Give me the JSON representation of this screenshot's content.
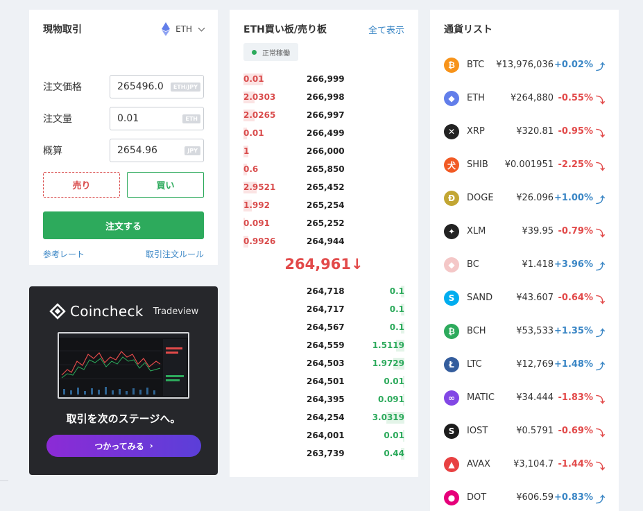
{
  "trade": {
    "title": "現物取引",
    "coin": "ETH",
    "rows": [
      {
        "label": "注文価格",
        "value": "265496.0",
        "unit": "ETH/JPY"
      },
      {
        "label": "注文量",
        "value": "0.01",
        "unit": "ETH"
      },
      {
        "label": "概算",
        "value": "2654.96",
        "unit": "JPY"
      }
    ],
    "sell_label": "売り",
    "buy_label": "買い",
    "order_label": "注文する",
    "ref_rate_link": "参考レート",
    "rules_link": "取引注文ルール"
  },
  "banner": {
    "brand": "Coincheck",
    "sub": "Tradeview",
    "caption": "取引を次のステージへ。",
    "button_label": "つかってみる"
  },
  "book": {
    "title": "ETH買い板/売り板",
    "show_all": "全て表示",
    "status": "正常稼働",
    "last_price": "264,961",
    "last_arrow": "↓",
    "asks": [
      {
        "qty": "0.01",
        "price": "266,999",
        "depth": 0.12
      },
      {
        "qty": "2.0303",
        "price": "266,998",
        "depth": 0.07
      },
      {
        "qty": "2.0265",
        "price": "266,997",
        "depth": 0.07
      },
      {
        "qty": "0.01",
        "price": "266,499",
        "depth": 0.02
      },
      {
        "qty": "1",
        "price": "266,000",
        "depth": 0.03
      },
      {
        "qty": "0.6",
        "price": "265,850",
        "depth": 0.02
      },
      {
        "qty": "2.9521",
        "price": "265,452",
        "depth": 0.08
      },
      {
        "qty": "1.992",
        "price": "265,254",
        "depth": 0.05
      },
      {
        "qty": "0.091",
        "price": "265,252",
        "depth": 0.01
      },
      {
        "qty": "0.9926",
        "price": "264,944",
        "depth": 0.03
      }
    ],
    "bids": [
      {
        "price": "264,718",
        "qty": "0.1",
        "depth": 0.02
      },
      {
        "price": "264,717",
        "qty": "0.1",
        "depth": 0.02
      },
      {
        "price": "264,567",
        "qty": "0.1",
        "depth": 0.02
      },
      {
        "price": "264,559",
        "qty": "1.5119",
        "depth": 0.05
      },
      {
        "price": "264,503",
        "qty": "1.9729",
        "depth": 0.07
      },
      {
        "price": "264,501",
        "qty": "0.01",
        "depth": 0.01
      },
      {
        "price": "264,395",
        "qty": "0.091",
        "depth": 0.01
      },
      {
        "price": "264,254",
        "qty": "3.0319",
        "depth": 0.11
      },
      {
        "price": "264,001",
        "qty": "0.01",
        "depth": 0.01
      },
      {
        "price": "263,739",
        "qty": "0.44",
        "depth": 0.02
      }
    ]
  },
  "coins": {
    "title": "通貨リスト",
    "items": [
      {
        "sym": "BTC",
        "price": "¥13,976,036",
        "chg": "+0.02%",
        "dir": "up",
        "color": "#f7931a",
        "glyph": "₿"
      },
      {
        "sym": "ETH",
        "price": "¥264,880",
        "chg": "-0.55%",
        "dir": "down",
        "color": "#627eea",
        "glyph": "◆"
      },
      {
        "sym": "XRP",
        "price": "¥320.81",
        "chg": "-0.95%",
        "dir": "down",
        "color": "#222222",
        "glyph": "✕"
      },
      {
        "sym": "SHIB",
        "price": "¥0.001951",
        "chg": "-2.25%",
        "dir": "down",
        "color": "#f15a24",
        "glyph": "犬"
      },
      {
        "sym": "DOGE",
        "price": "¥26.096",
        "chg": "+1.00%",
        "dir": "up",
        "color": "#c2a633",
        "glyph": "Ð"
      },
      {
        "sym": "XLM",
        "price": "¥39.95",
        "chg": "-0.79%",
        "dir": "down",
        "color": "#222222",
        "glyph": "✦"
      },
      {
        "sym": "BC",
        "price": "¥1.418",
        "chg": "+3.96%",
        "dir": "up",
        "color": "#f4c7c7",
        "glyph": "◆"
      },
      {
        "sym": "SAND",
        "price": "¥43.607",
        "chg": "-0.64%",
        "dir": "down",
        "color": "#00adef",
        "glyph": "S"
      },
      {
        "sym": "BCH",
        "price": "¥53,533",
        "chg": "+1.35%",
        "dir": "up",
        "color": "#2daa5c",
        "glyph": "₿"
      },
      {
        "sym": "LTC",
        "price": "¥12,769",
        "chg": "+1.48%",
        "dir": "up",
        "color": "#345d9d",
        "glyph": "Ł"
      },
      {
        "sym": "MATIC",
        "price": "¥34.444",
        "chg": "-1.83%",
        "dir": "down",
        "color": "#8247e5",
        "glyph": "∞"
      },
      {
        "sym": "IOST",
        "price": "¥0.5791",
        "chg": "-0.69%",
        "dir": "down",
        "color": "#1c1c1c",
        "glyph": "S"
      },
      {
        "sym": "AVAX",
        "price": "¥3,104.7",
        "chg": "-1.44%",
        "dir": "down",
        "color": "#e84142",
        "glyph": "▲"
      },
      {
        "sym": "DOT",
        "price": "¥606.59",
        "chg": "+0.83%",
        "dir": "up",
        "color": "#e6007a",
        "glyph": "●"
      }
    ]
  }
}
